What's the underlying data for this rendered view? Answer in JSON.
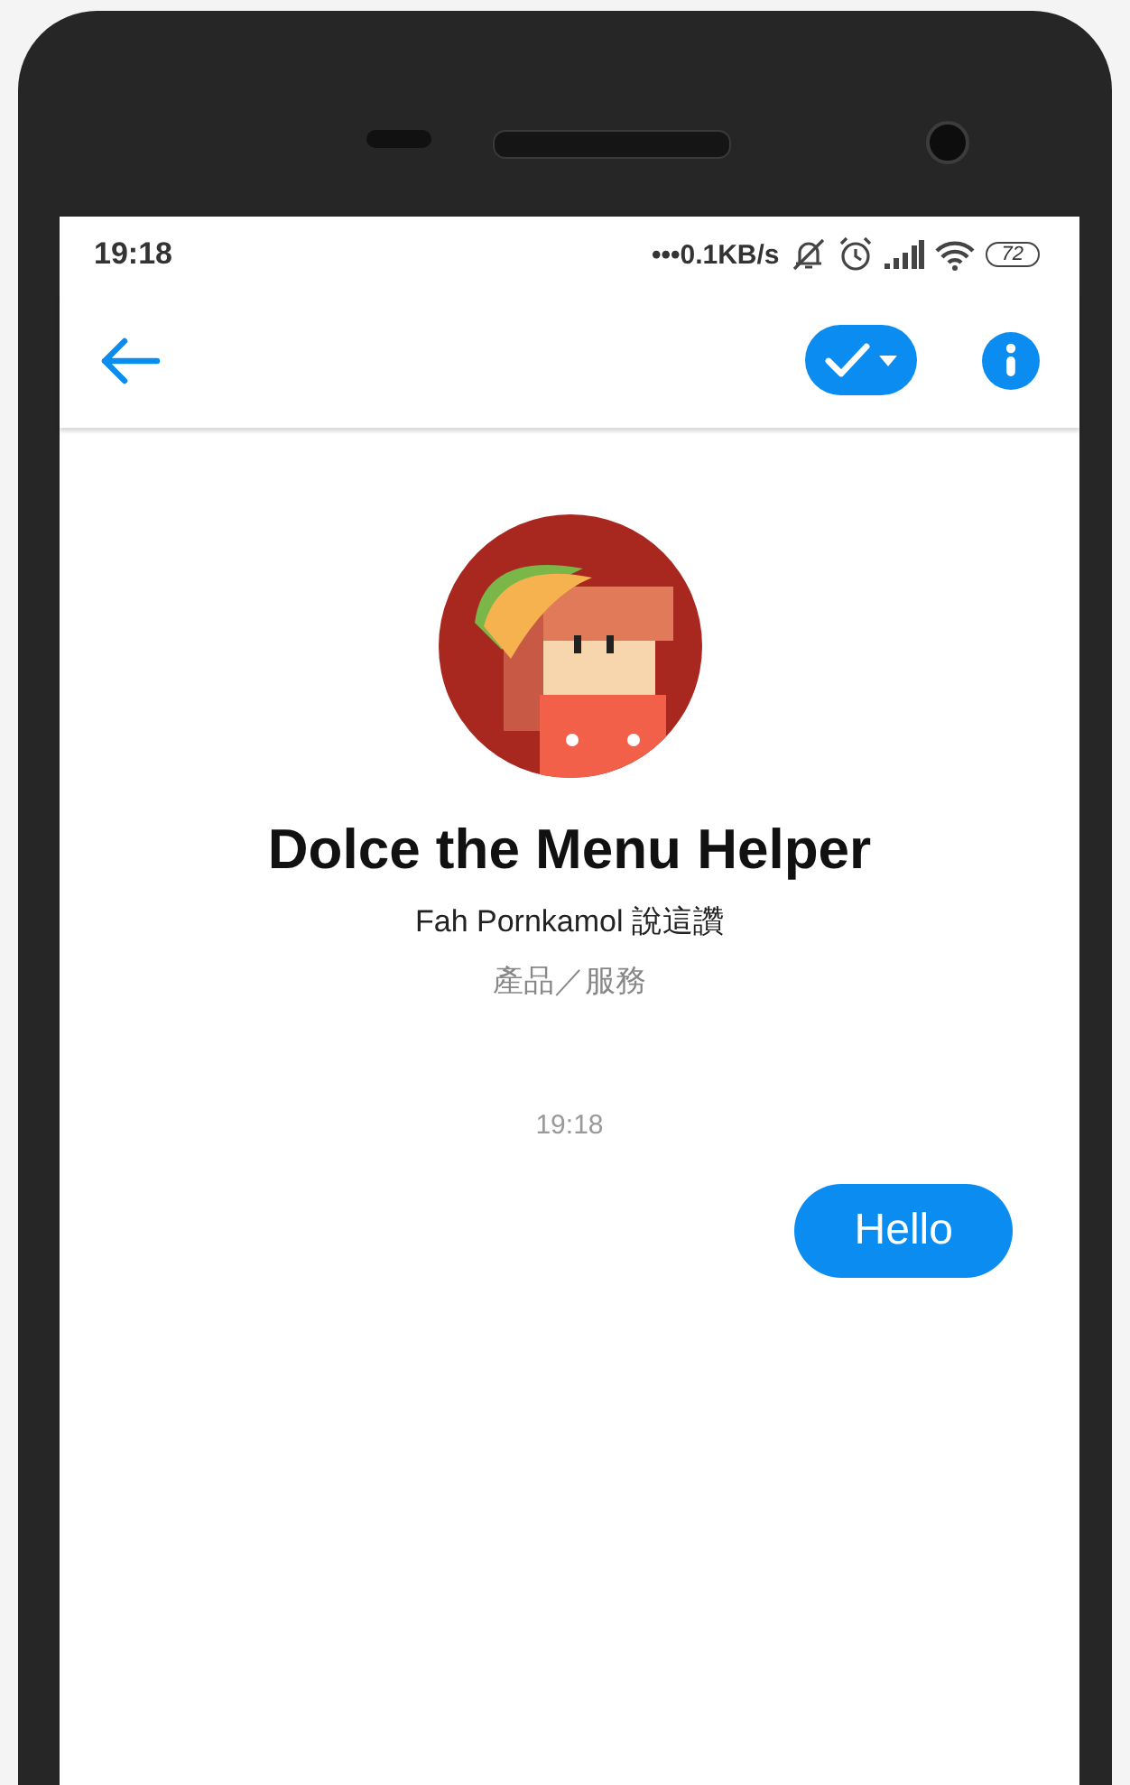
{
  "status_bar": {
    "time": "19:18",
    "network_speed": "•••0.1KB/s",
    "battery": "72"
  },
  "profile": {
    "name": "Dolce the Menu Helper",
    "likes": "Fah Pornkamol 說這讚",
    "category": "產品／服務"
  },
  "messages": [
    {
      "kind": "timestamp",
      "text": "19:18"
    },
    {
      "kind": "outgoing",
      "text": "Hello"
    }
  ]
}
